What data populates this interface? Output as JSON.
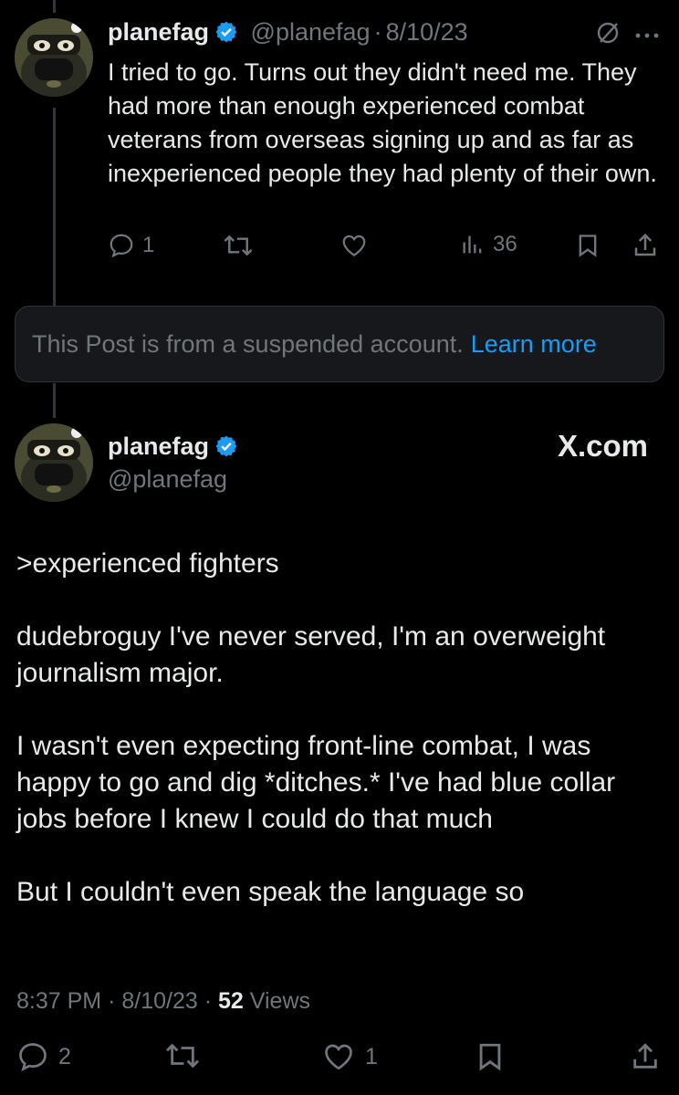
{
  "colors": {
    "background": "#000000",
    "text": "#e7e9ea",
    "muted": "#71767b",
    "link": "#1d9bf0",
    "verified": "#1d9bf0"
  },
  "tweet1": {
    "display_name": "planefag",
    "handle": "@planefag",
    "separator": "·",
    "date": "8/10/23",
    "text": "I tried to go. Turns out they didn't need me. They had more than enough experienced combat veterans from overseas signing up and as far as inexperienced people they had plenty of their own.",
    "reply_count": "1",
    "view_count": "36",
    "icons": [
      "grok-icon",
      "more-icon",
      "reply-icon",
      "retweet-icon",
      "like-icon",
      "views-icon",
      "bookmark-icon",
      "share-icon"
    ]
  },
  "suspended": {
    "message": "This Post is from a suspended account.",
    "link": "Learn more"
  },
  "tweet2": {
    "display_name": "planefag",
    "handle": "@planefag",
    "watermark": "X.com",
    "paragraphs": [
      ">experienced fighters",
      "dudebroguy I've never served, I'm an overweight journalism major.",
      "I wasn't even expecting front-line combat, I was happy to go and dig *ditches.* I've had blue collar jobs before I knew I could do that much",
      "But I couldn't even speak the language so"
    ],
    "time": "8:37 PM",
    "separator": "·",
    "date": "8/10/23",
    "views_count": "52",
    "views_label": "Views",
    "reply_count": "2",
    "like_count": "1"
  }
}
